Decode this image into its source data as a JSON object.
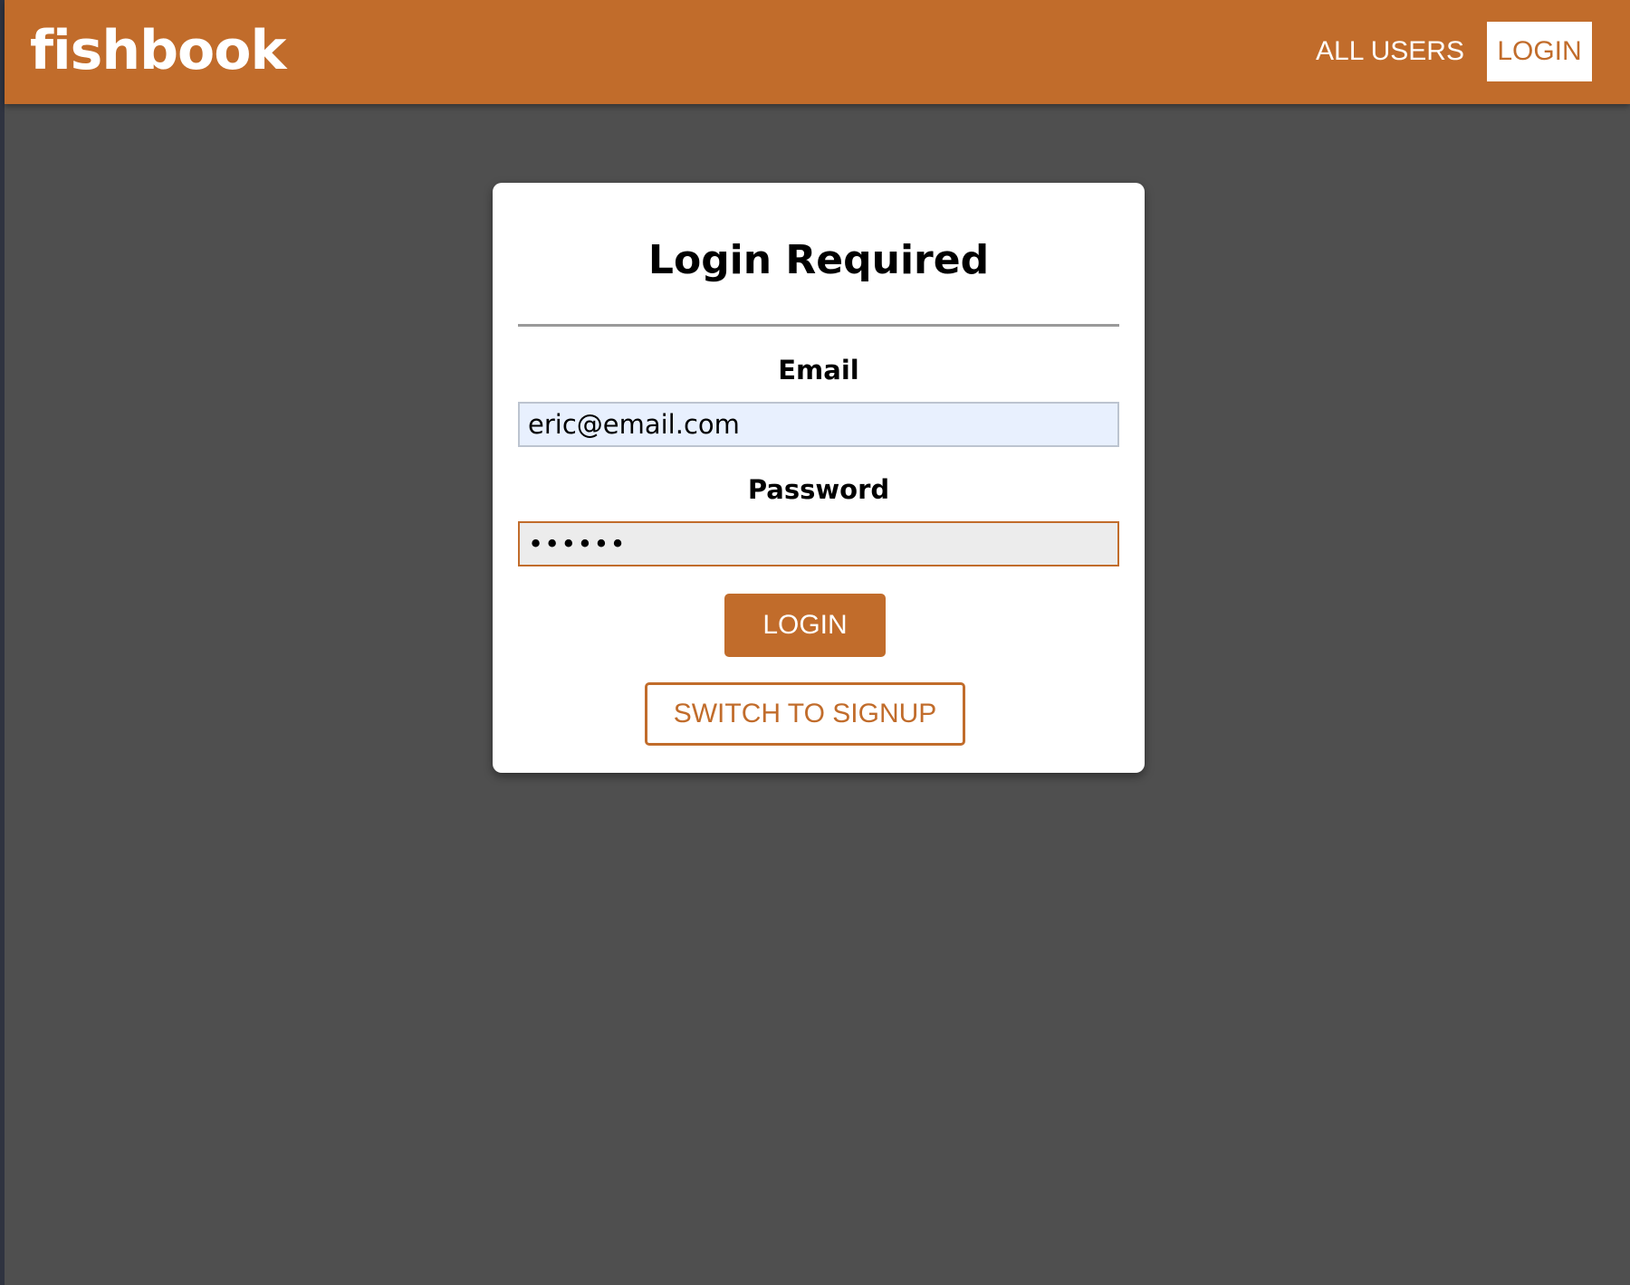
{
  "header": {
    "logo": "fishbook",
    "nav": {
      "all_users": "ALL USERS",
      "login": "LOGIN"
    }
  },
  "auth_card": {
    "title": "Login Required",
    "email": {
      "label": "Email",
      "value": "eric@email.com"
    },
    "password": {
      "label": "Password",
      "value": "••••••"
    },
    "login_button": "LOGIN",
    "switch_button": "SWITCH TO SIGNUP"
  },
  "colors": {
    "brand": "#c16c2b",
    "background": "#4f4f4f",
    "card": "#ffffff",
    "email_autofill": "#e8f0fe",
    "password_field": "#ececec"
  }
}
